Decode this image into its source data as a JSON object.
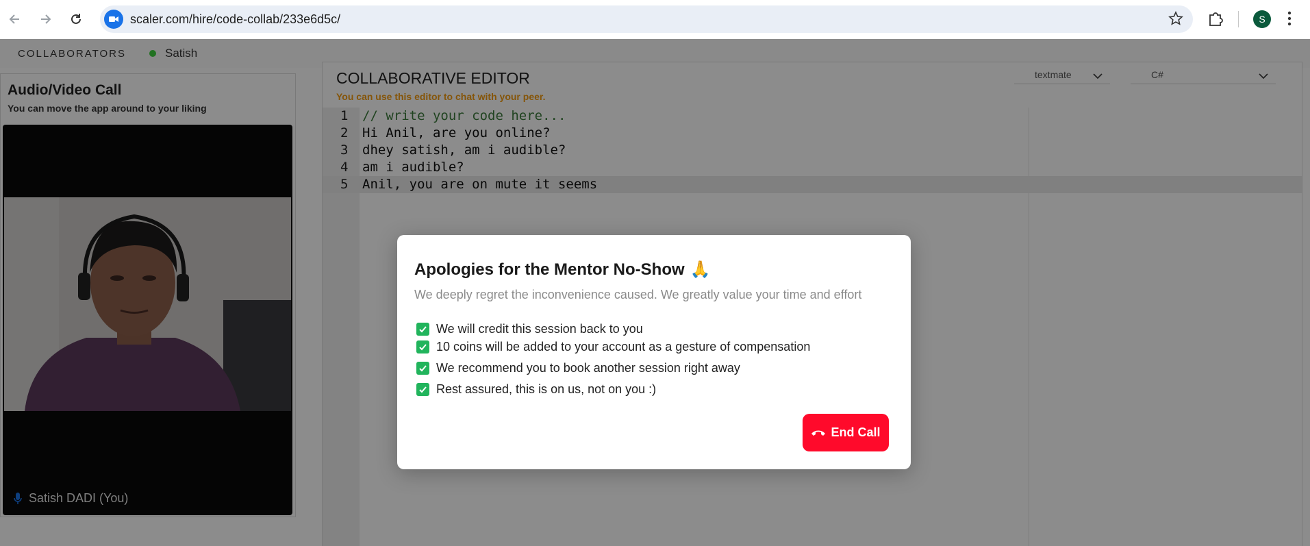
{
  "browser": {
    "url": "scaler.com/hire/code-collab/233e6d5c/",
    "profile_initial": "S"
  },
  "topbar": {
    "collaborators_label": "COLLABORATORS",
    "collaborator_name": "Satish",
    "online_color": "#3ecf3e"
  },
  "av_panel": {
    "title": "Audio/Video Call",
    "subtitle": "You can move the app around to your liking",
    "participant_label": "Satish DADI (You)"
  },
  "editor": {
    "title": "COLLABORATIVE EDITOR",
    "subtitle": "You can use this editor to chat with your peer.",
    "theme_select": "textmate",
    "language_select": "C#",
    "lines": [
      {
        "num": "1",
        "text": "// write your code here..."
      },
      {
        "num": "2",
        "text": "Hi Anil, are you online?"
      },
      {
        "num": "3",
        "text": "dhey satish, am i audible?"
      },
      {
        "num": "4",
        "text": "am i audible?"
      },
      {
        "num": "5",
        "text": "Anil, you are on mute it seems"
      }
    ]
  },
  "modal": {
    "title": "Apologies for the Mentor No-Show",
    "title_emoji": "🙏",
    "subtitle": "We deeply regret the inconvenience caused. We greatly value your time and effort",
    "items": [
      "We will credit this session back to you",
      "10 coins will be added to your account as a gesture of compensation",
      "We recommend you to book another session right away",
      "Rest assured, this is on us, not on you :)"
    ],
    "end_call_label": "End Call",
    "end_call_color": "#ff0a2b",
    "check_color": "#21b45c"
  }
}
